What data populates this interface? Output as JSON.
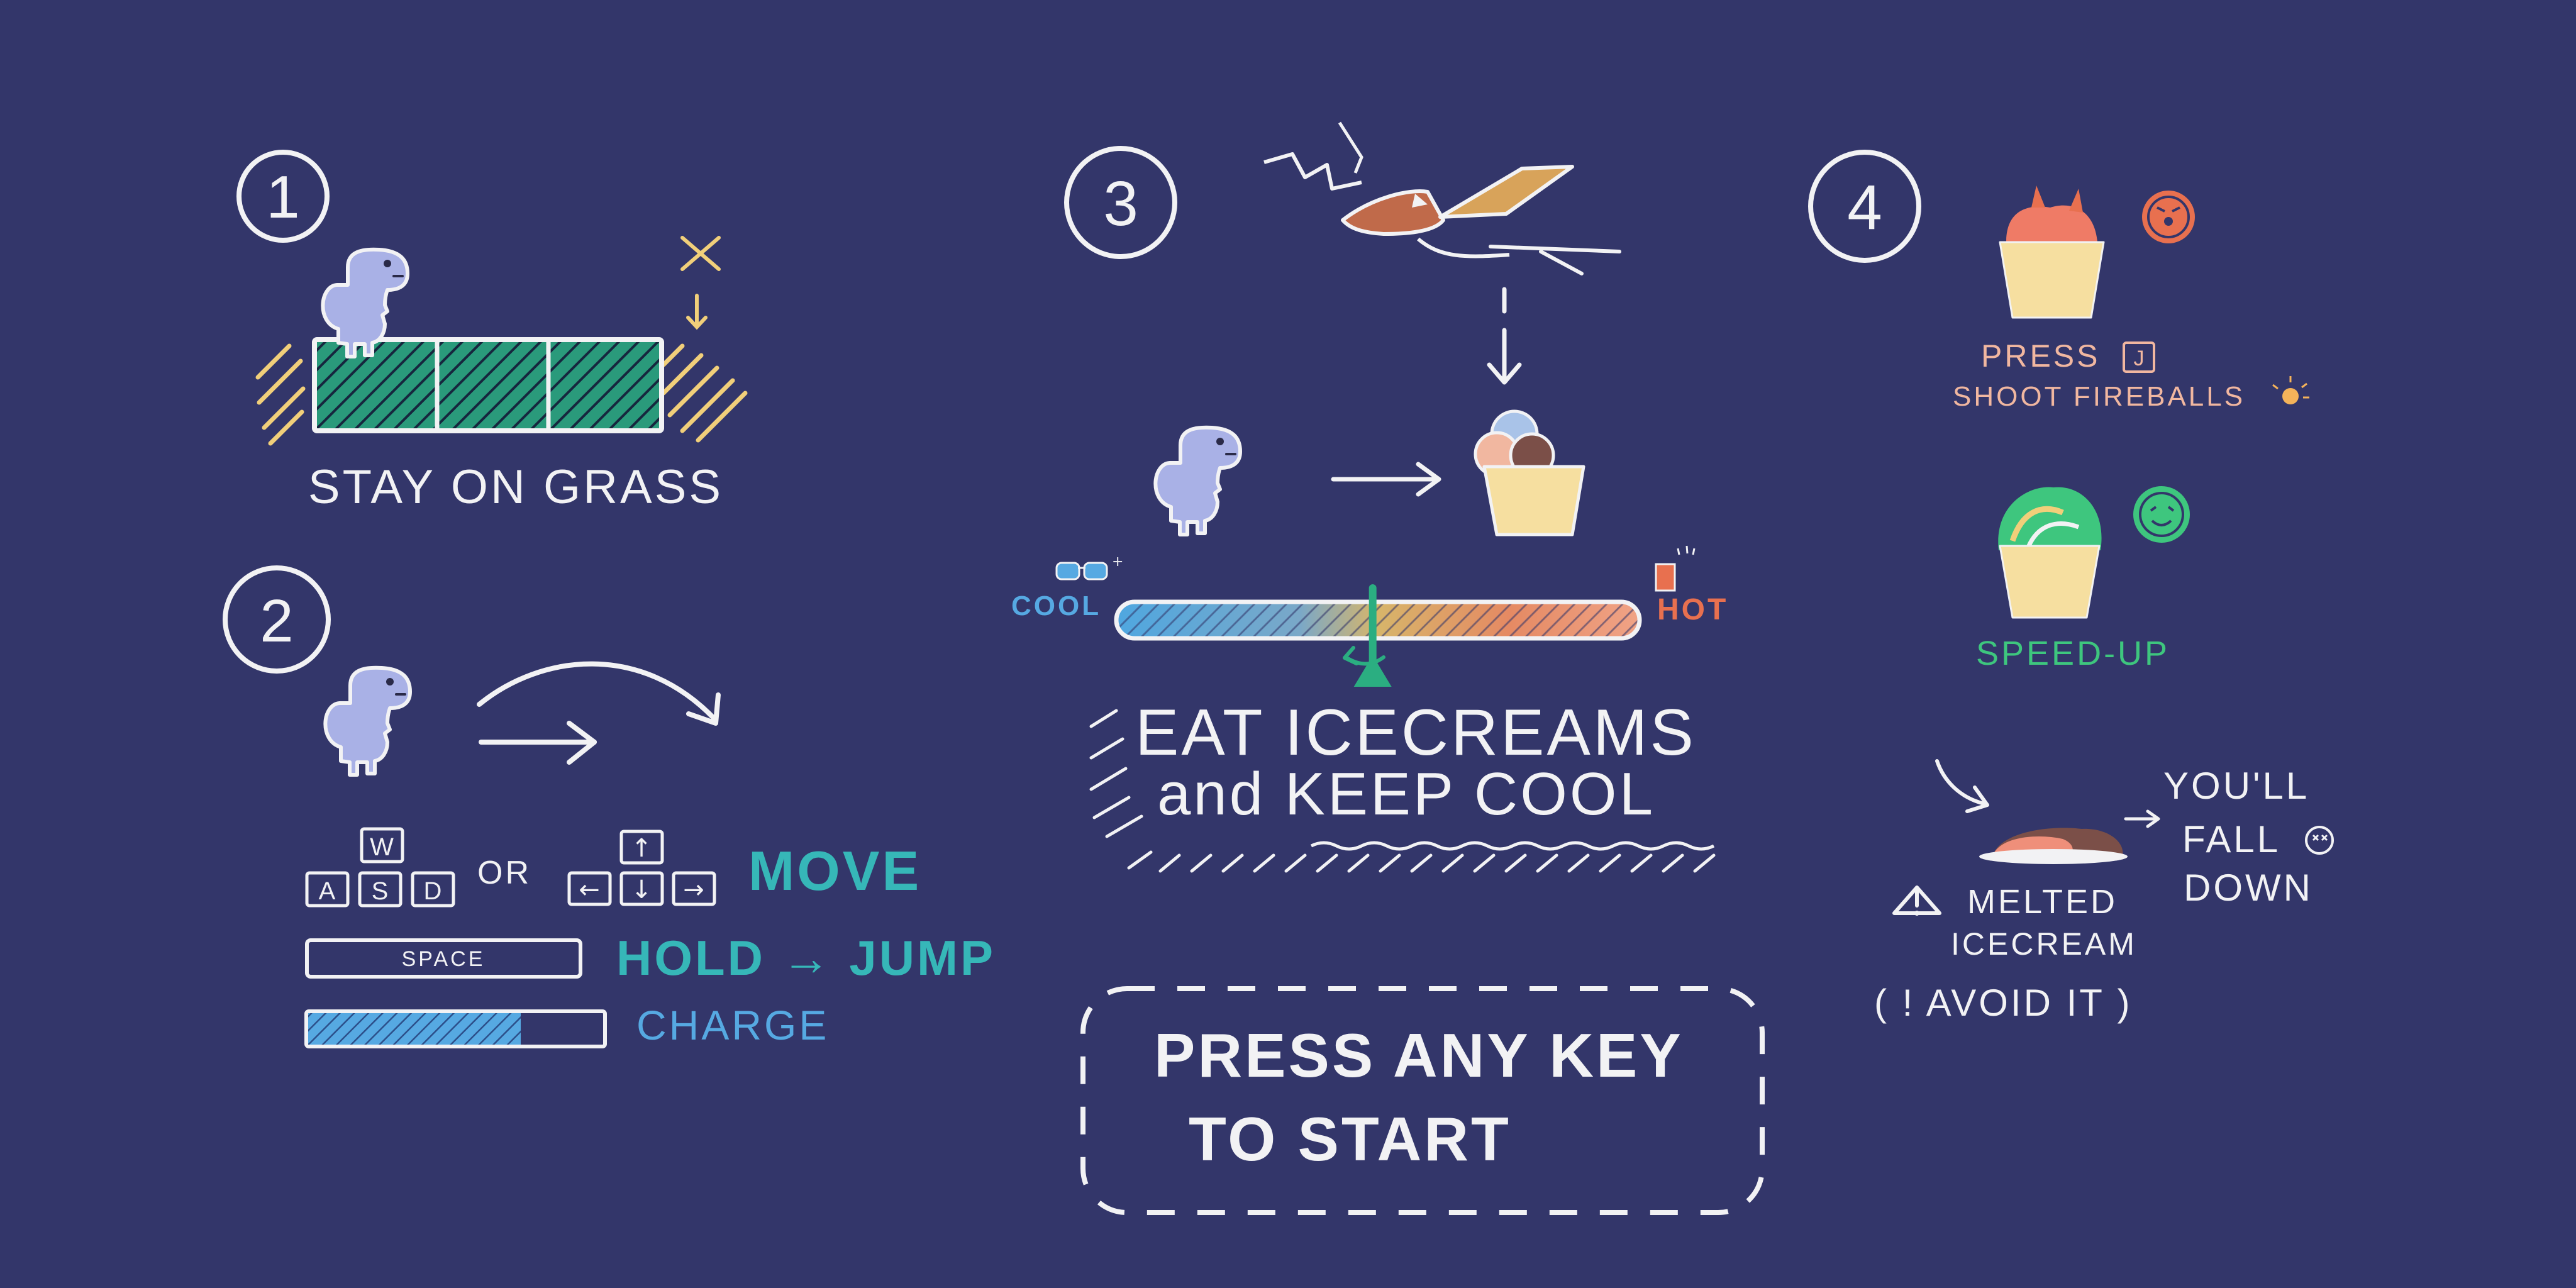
{
  "colors": {
    "background": "#33366a",
    "chalk": "#f2f2f4",
    "grass": "#2a9a7b",
    "dino": "#a9b1e6",
    "teal": "#36b7b8",
    "blue": "#56a9e2",
    "orange": "#e8704f",
    "yellow": "#f1cf7a",
    "green": "#3ec67e",
    "peach": "#f1b7a0"
  },
  "steps": {
    "s1": {
      "number": "1",
      "caption": "STAY ON GRASS"
    },
    "s2": {
      "number": "2",
      "keys": {
        "w": "W",
        "a": "A",
        "s": "S",
        "d": "D",
        "or": "OR",
        "up": "↑",
        "left": "←",
        "down": "↓",
        "right": "→"
      },
      "move_label": "MOVE",
      "space_key": "SPACE",
      "hold_jump_label": "HOLD → JUMP",
      "charge_label": "CHARGE",
      "charge_level": 0.72
    },
    "s3": {
      "number": "3",
      "cool_label": "COOL",
      "hot_label": "HOT",
      "thermo_position": 0.49,
      "line1": "EAT ICECREAMS",
      "line2": "and KEEP COOL"
    },
    "s4": {
      "number": "4",
      "press_label": "PRESS",
      "key_j": "J",
      "fireball_label": "SHOOT FIREBALLS",
      "speed_label": "SPEED-UP",
      "melted_line1": "MELTED",
      "melted_line2": "ICECREAM",
      "avoid_label": "( ! AVOID IT )",
      "fall_line1": "YOU'LL",
      "fall_line2": "FALL",
      "fall_line3": "DOWN"
    }
  },
  "start_prompt": {
    "line1": "PRESS ANY KEY",
    "line2": "TO START"
  }
}
